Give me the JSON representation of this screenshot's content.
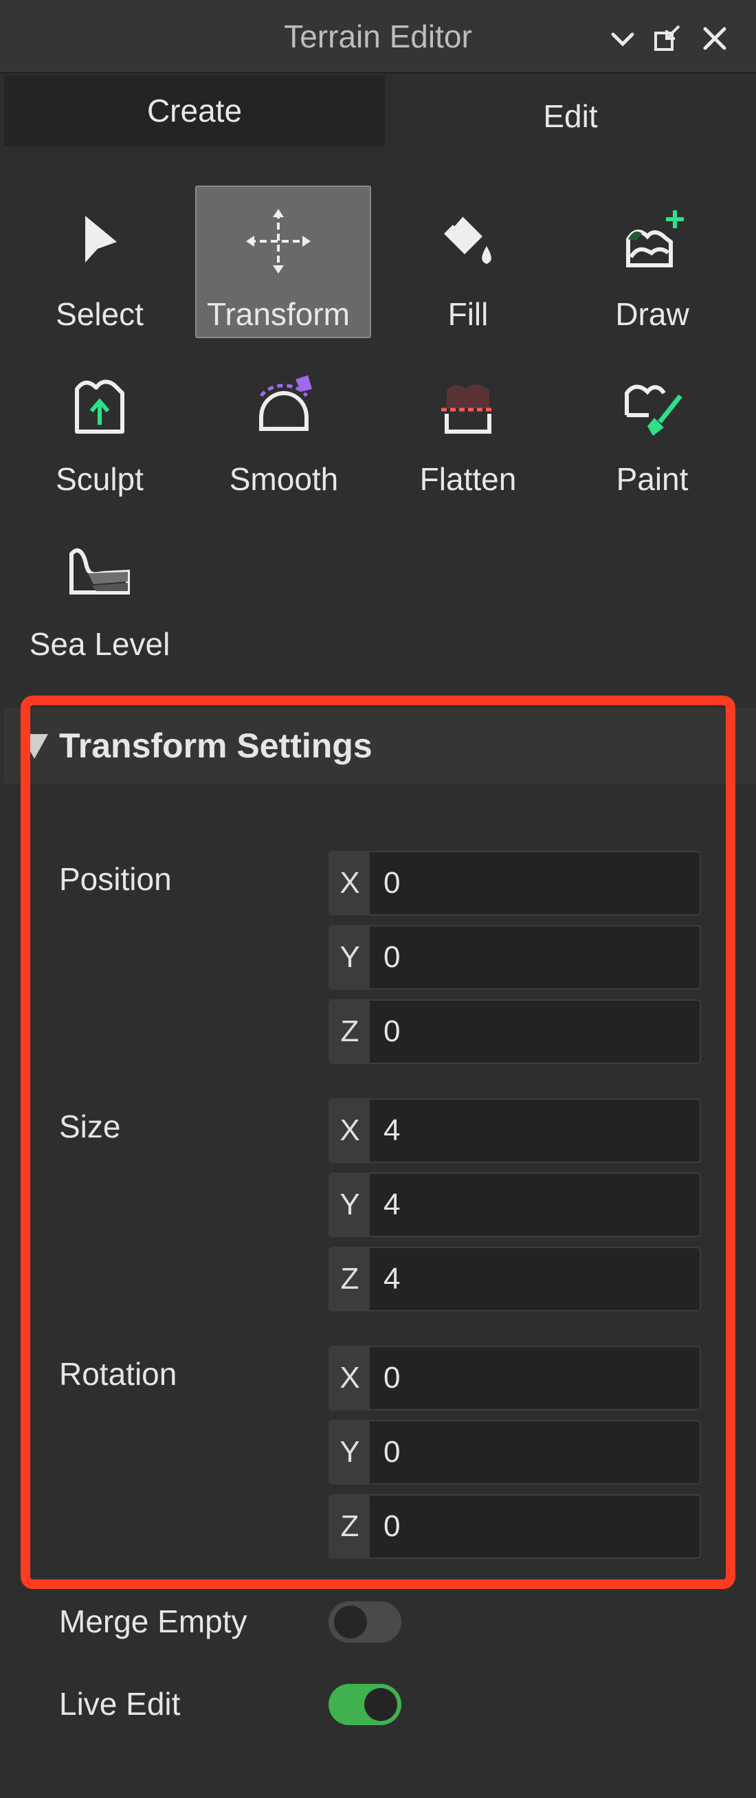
{
  "window": {
    "title": "Terrain Editor",
    "icons": [
      "chevron-down-icon",
      "undock-icon",
      "close-icon"
    ]
  },
  "tabs": [
    {
      "label": "Create",
      "active": false
    },
    {
      "label": "Edit",
      "active": true
    }
  ],
  "tools": [
    {
      "label": "Select",
      "icon": "cursor-arrow-icon"
    },
    {
      "label": "Transform",
      "icon": "move-arrows-icon",
      "selected": true
    },
    {
      "label": "Fill",
      "icon": "paint-bucket-icon"
    },
    {
      "label": "Draw",
      "icon": "draw-terrain-icon"
    },
    {
      "label": "Sculpt",
      "icon": "sculpt-icon"
    },
    {
      "label": "Smooth",
      "icon": "smooth-icon"
    },
    {
      "label": "Flatten",
      "icon": "flatten-icon"
    },
    {
      "label": "Paint",
      "icon": "paint-brush-icon"
    },
    {
      "label": "Sea Level",
      "icon": "sea-level-icon"
    }
  ],
  "settings": {
    "title": "Transform Settings",
    "position": {
      "label": "Position",
      "x": "0",
      "y": "0",
      "z": "0"
    },
    "size": {
      "label": "Size",
      "x": "4",
      "y": "4",
      "z": "4"
    },
    "rotation": {
      "label": "Rotation",
      "x": "0",
      "y": "0",
      "z": "0"
    },
    "axis_labels": {
      "x": "X",
      "y": "Y",
      "z": "Z"
    }
  },
  "options": {
    "merge_empty": {
      "label": "Merge Empty",
      "on": false
    },
    "live_edit": {
      "label": "Live Edit",
      "on": true
    }
  },
  "colors": {
    "accent_green": "#3fb24f",
    "highlight_red": "#ff3b21",
    "icon_green": "#2fe08a",
    "icon_purple": "#a268f0"
  }
}
